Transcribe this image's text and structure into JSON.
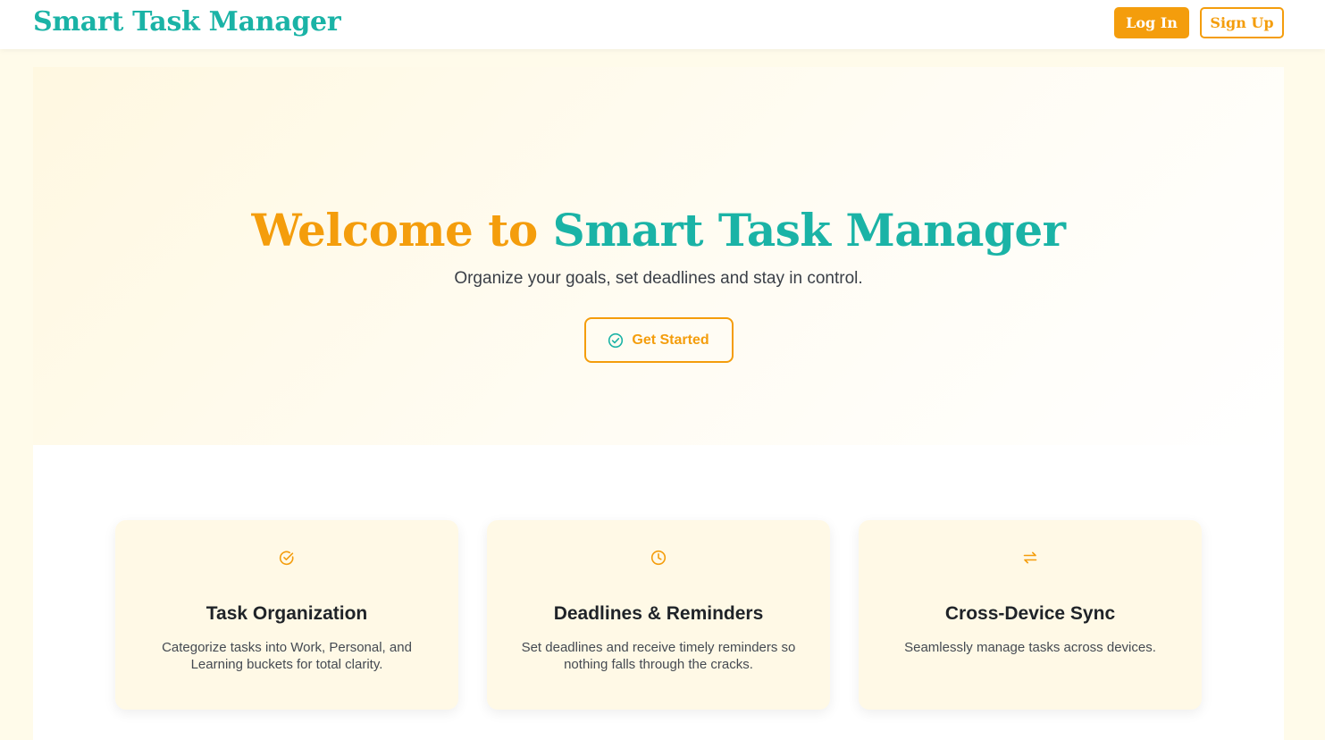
{
  "colors": {
    "teal": "#1ab3a6",
    "orange": "#f49d0c",
    "page_background": "#fffbea"
  },
  "navbar": {
    "brand": "Smart Task Manager",
    "login_label": "Log In",
    "signup_label": "Sign Up"
  },
  "hero": {
    "title_part1": "Welcome to",
    "title_part2": "Smart Task Manager",
    "subtitle": "Organize your goals, set deadlines and stay in control.",
    "cta_label": "Get Started",
    "cta_icon": "check-circle-icon"
  },
  "features": [
    {
      "icon": "check-circle-icon",
      "title": "Task Organization",
      "description": "Categorize tasks into Work, Personal, and Learning buckets for total clarity."
    },
    {
      "icon": "clock-icon",
      "title": "Deadlines & Reminders",
      "description": "Set deadlines and receive timely reminders so nothing falls through the cracks."
    },
    {
      "icon": "sync-arrows-icon",
      "title": "Cross-Device Sync",
      "description": "Seamlessly manage tasks across devices."
    }
  ]
}
